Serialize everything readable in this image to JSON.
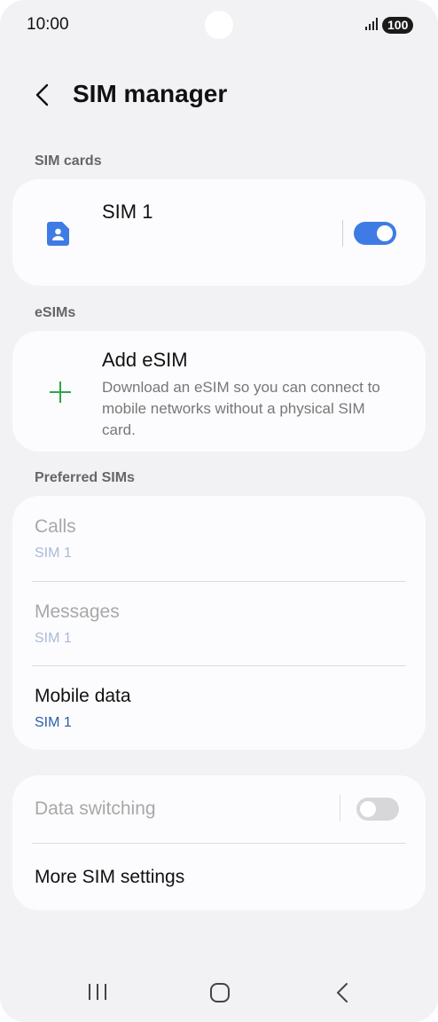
{
  "status_bar": {
    "time": "10:00",
    "battery": "100"
  },
  "header": {
    "title": "SIM manager"
  },
  "sim_cards": {
    "section_label": "SIM cards",
    "sim1": {
      "name": "SIM 1",
      "enabled": true
    }
  },
  "esims": {
    "section_label": "eSIMs",
    "add": {
      "title": "Add eSIM",
      "description": "Download an eSIM so you can connect to mobile networks without a physical SIM card."
    }
  },
  "preferred_sims": {
    "section_label": "Preferred SIMs",
    "items": [
      {
        "title": "Calls",
        "value": "SIM 1",
        "enabled": false
      },
      {
        "title": "Messages",
        "value": "SIM 1",
        "enabled": false
      },
      {
        "title": "Mobile data",
        "value": "SIM 1",
        "enabled": true
      }
    ]
  },
  "more": {
    "data_switching": {
      "title": "Data switching",
      "enabled": false,
      "checked": false
    },
    "more_settings": {
      "title": "More SIM settings"
    }
  },
  "colors": {
    "accent": "#3e7be5",
    "plus": "#2aa84a",
    "sim_icon": "#3e7be5"
  },
  "icons": [
    "back-chevron-icon",
    "sim-card-icon",
    "plus-icon",
    "recent-apps-icon",
    "home-icon",
    "back-icon"
  ]
}
